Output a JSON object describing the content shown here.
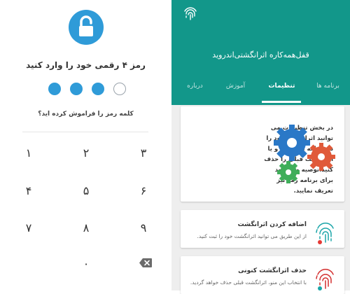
{
  "pin_screen": {
    "title": "رمز ۴ رقمی خود را وارد کنید",
    "forgot_link": "کلمه رمز را فراموش کرده اید؟",
    "dots": [
      {
        "state": "empty"
      },
      {
        "state": "filled"
      },
      {
        "state": "filled"
      },
      {
        "state": "filled"
      }
    ],
    "keys": {
      "k1": "۱",
      "k2": "۲",
      "k3": "۳",
      "k4": "۴",
      "k5": "۵",
      "k6": "۶",
      "k7": "۷",
      "k8": "۸",
      "k9": "۹",
      "k0": "۰"
    },
    "backspace_icon": "backspace-icon",
    "lock_icon": "unlock-icon",
    "accent_color": "#2f9bd8"
  },
  "app": {
    "title": "قفل‌همه‌کاره اثرانگشتی‌اندروید",
    "header_color": "#12978a",
    "tabs": [
      {
        "label": "برنامه ها",
        "active": false
      },
      {
        "label": "تنظیمات",
        "active": true
      },
      {
        "label": "آموزش",
        "active": false
      },
      {
        "label": "درباره",
        "active": false
      }
    ],
    "intro_card": {
      "text": "در بخش تنظیمات می توانید اثرانگشت خود را در برنامه ثبت کنید و یا اثرانگشت قبلی را حذف کنید.توصیه می شود برای برنامه رمز نیز تعریف نمایید.",
      "icon": "gears-icon"
    },
    "add_card": {
      "title": "اضافه کردن اثرانگشت",
      "desc": "از این طریق می توانید اثرانگشت خود را ثبت کنید.",
      "icon": "fingerprint-add-icon"
    },
    "remove_card": {
      "title": "حذف اثرانگشت کنونی",
      "desc": "با انتخاب این منو، اثرانگشت قبلی حذف خواهد گردید.",
      "icon": "fingerprint-remove-icon"
    }
  }
}
